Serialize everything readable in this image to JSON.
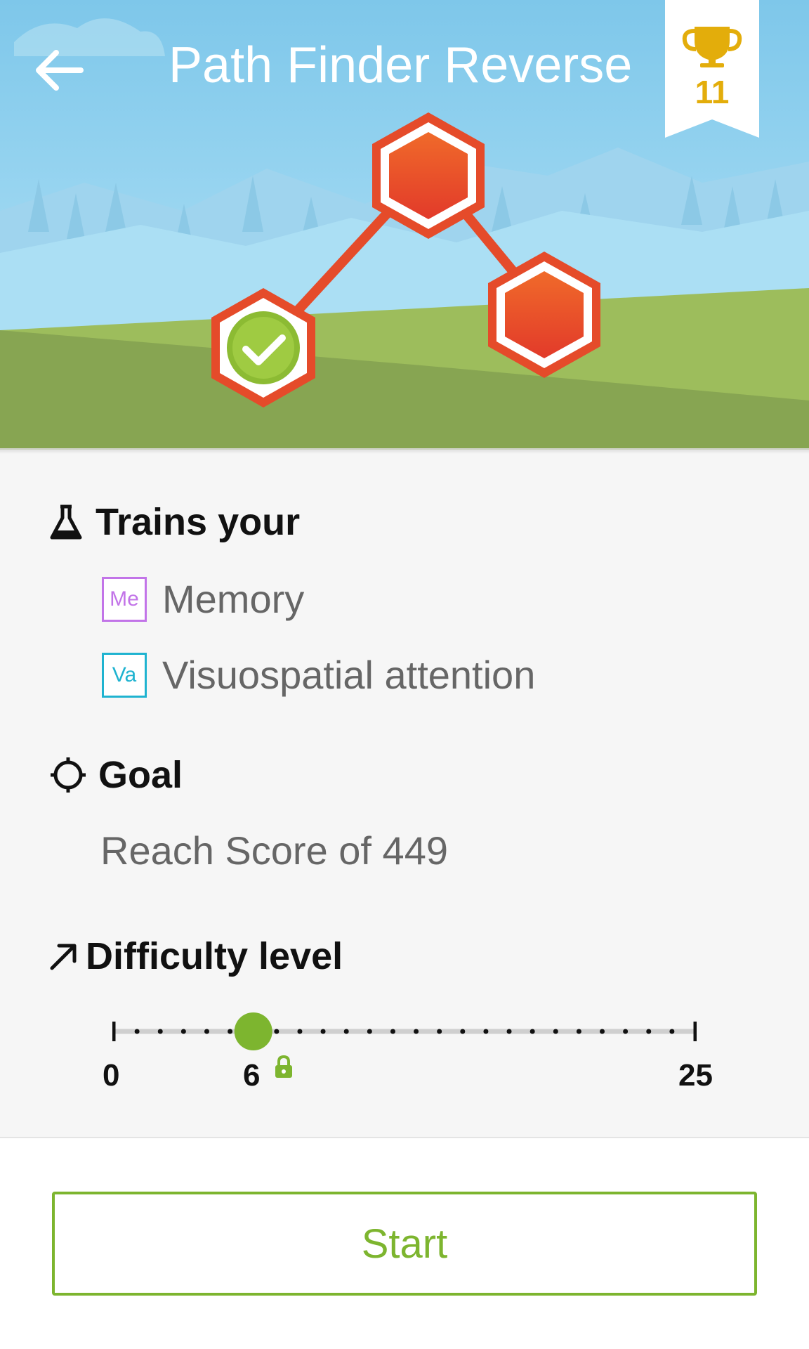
{
  "header": {
    "title": "Path Finder Reverse",
    "back_icon": "arrow-left-icon",
    "trophy_icon": "trophy-icon",
    "trophy_count": "11"
  },
  "trains": {
    "heading": "Trains your",
    "icon": "flask-icon",
    "skills": [
      {
        "abbr": "Me",
        "label": "Memory",
        "color": "#c274e8"
      },
      {
        "abbr": "Va",
        "label": "Visuospatial attention",
        "color": "#1fb3d0"
      }
    ]
  },
  "goal": {
    "heading": "Goal",
    "icon": "target-icon",
    "text": "Reach Score of 449"
  },
  "difficulty": {
    "heading": "Difficulty level",
    "icon": "arrow-up-right-icon",
    "min": "0",
    "max": "25",
    "current": "6",
    "lock_icon": "lock-icon"
  },
  "footer": {
    "start_label": "Start"
  },
  "colors": {
    "accent_green": "#7db52f",
    "trophy_gold": "#e3ad0b",
    "hex_red": "#e54b2a"
  }
}
